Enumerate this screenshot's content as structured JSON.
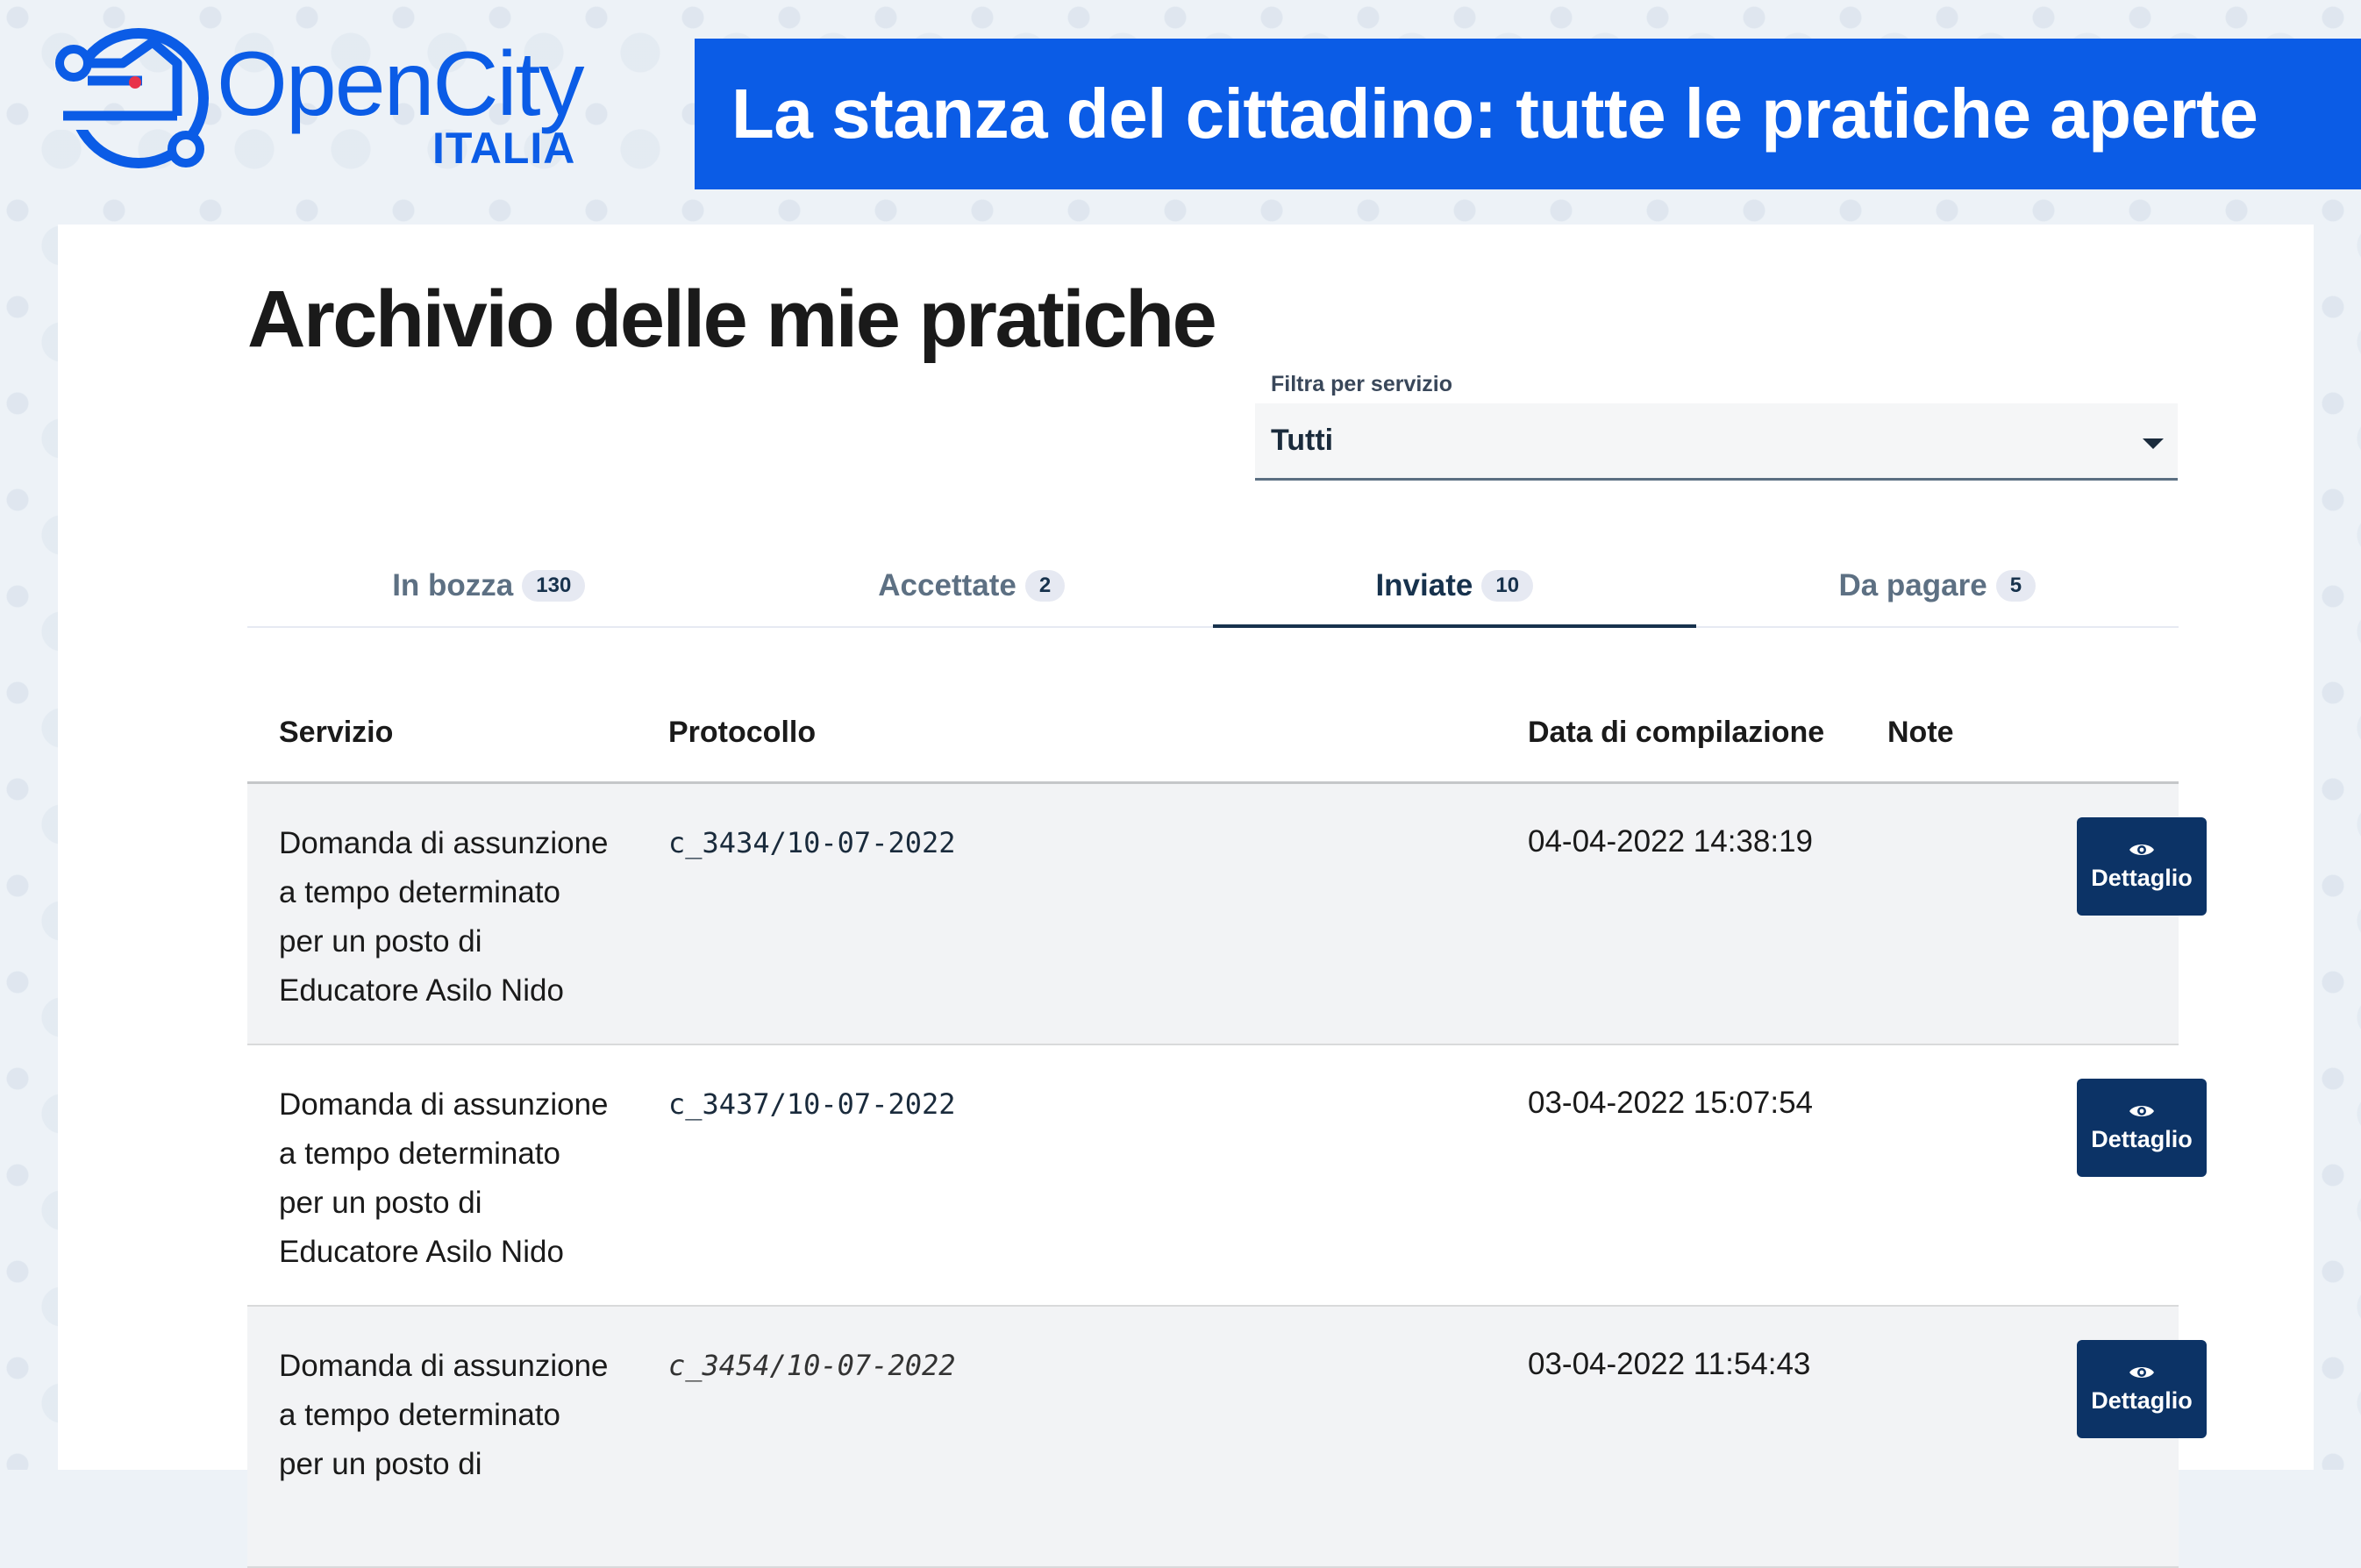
{
  "brand": {
    "name": "OpenCity",
    "sub": "ITALIA",
    "color": "#0b5ce6"
  },
  "banner": {
    "text": "La stanza del cittadino: tutte le pratiche aperte"
  },
  "page": {
    "title": "Archivio delle mie pratiche"
  },
  "filter": {
    "label": "Filtra per servizio",
    "selected": "Tutti"
  },
  "tabs": [
    {
      "label": "In bozza",
      "count": "130",
      "active": false
    },
    {
      "label": "Accettate",
      "count": "2",
      "active": false
    },
    {
      "label": "Inviate",
      "count": "10",
      "active": true
    },
    {
      "label": "Da pagare",
      "count": "5",
      "active": false
    }
  ],
  "table": {
    "headers": {
      "service": "Servizio",
      "protocol": "Protocollo",
      "date": "Data di compilazione",
      "note": "Note"
    },
    "rows": [
      {
        "service_lines": [
          "Domanda di assunzione",
          "a tempo determinato",
          "per un posto di",
          "Educatore Asilo Nido"
        ],
        "protocol": "c_3434/10-07-2022",
        "date": "04-04-2022 14:38:19",
        "action": "Dettaglio"
      },
      {
        "service_lines": [
          "Domanda di assunzione",
          "a tempo determinato",
          "per un posto di",
          "Educatore Asilo Nido"
        ],
        "protocol": "c_3437/10-07-2022",
        "date": "03-04-2022 15:07:54",
        "action": "Dettaglio"
      },
      {
        "service_lines": [
          "Domanda di assunzione",
          "a tempo determinato",
          "per un posto di"
        ],
        "protocol": "c_3454/10-07-2022",
        "date": "03-04-2022 11:54:43",
        "action": "Dettaglio"
      }
    ]
  }
}
